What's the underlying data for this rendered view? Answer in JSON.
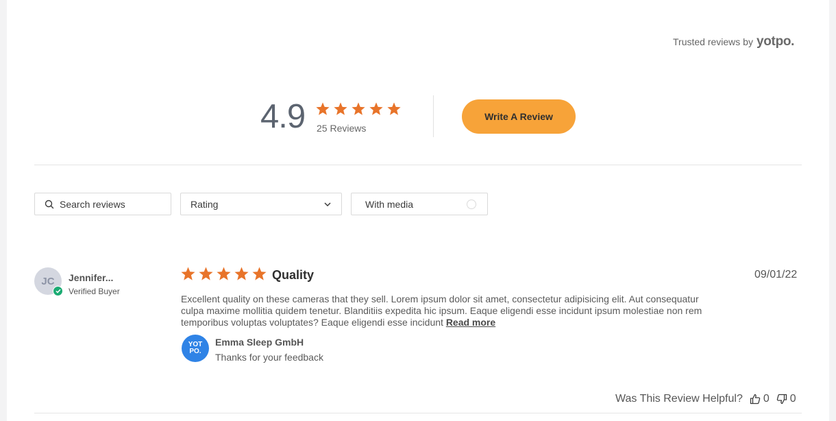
{
  "trusted": {
    "text": "Trusted reviews by",
    "brand": "yotpo."
  },
  "summary": {
    "average": "4.9",
    "stars": 5,
    "review_count": "25 Reviews",
    "write_review_label": "Write A Review"
  },
  "filters": {
    "search_placeholder": "Search reviews",
    "rating_label": "Rating",
    "media_label": "With media"
  },
  "review": {
    "initials": "JC",
    "name": "Jennifer...",
    "badge": "Verified Buyer",
    "stars": 5,
    "title": "Quality",
    "date": "09/01/22",
    "body": "Excellent quality on these cameras that they sell. Lorem ipsum dolor sit amet, consectetur adipisicing elit. Aut consequatur culpa maxime mollitia quidem tenetur. Blanditiis expedita hic ipsum. Eaque eligendi esse incidunt ipsum molestiae non rem temporibus voluptas voluptates?  Eaque eligendi esse incidunt ",
    "read_more": "Read more",
    "reply": {
      "logo_line1": "YOT",
      "logo_line2": "PO.",
      "name": "Emma Sleep GmbH",
      "text": "Thanks for your feedback"
    },
    "helpful": {
      "question": "Was This Review Helpful?",
      "up_count": "0",
      "down_count": "0"
    }
  },
  "colors": {
    "star": "#e8742a",
    "accent_button": "#f7a339",
    "verified": "#1cab73",
    "reply_logo": "#2f83e6"
  }
}
